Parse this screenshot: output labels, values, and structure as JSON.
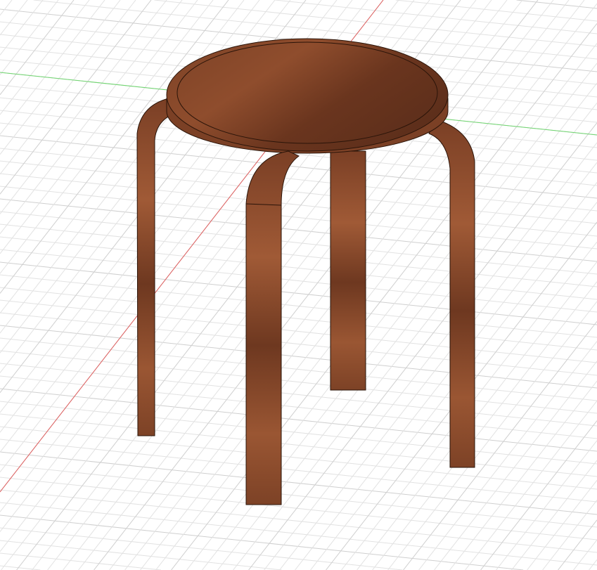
{
  "viewport": {
    "colors": {
      "background": "#ffffff",
      "grid_minor": "#e2e2e2",
      "grid_major": "#cfcfcf",
      "x_axis": "#e06060",
      "y_axis": "#6fd66f",
      "wood_light": "#9a5330",
      "wood_mid": "#7e4227",
      "wood_dark": "#5e301b",
      "edge": "#2a1409"
    }
  }
}
